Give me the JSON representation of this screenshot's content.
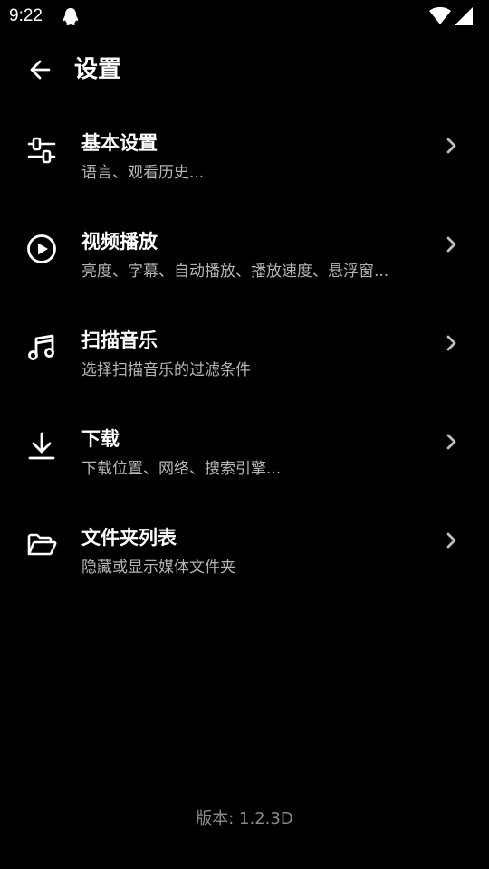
{
  "status_bar": {
    "time": "9:22"
  },
  "header": {
    "title": "设置"
  },
  "settings": {
    "items": [
      {
        "title": "基本设置",
        "subtitle": "语言、观看历史...",
        "icon": "sliders-icon"
      },
      {
        "title": "视频播放",
        "subtitle": "亮度、字幕、自动播放、播放速度、悬浮窗...",
        "icon": "play-circle-icon"
      },
      {
        "title": "扫描音乐",
        "subtitle": "选择扫描音乐的过滤条件",
        "icon": "music-note-icon"
      },
      {
        "title": "下载",
        "subtitle": "下载位置、网络、搜索引擎...",
        "icon": "download-icon"
      },
      {
        "title": "文件夹列表",
        "subtitle": "隐藏或显示媒体文件夹",
        "icon": "folder-open-icon"
      }
    ]
  },
  "footer": {
    "version": "版本: 1.2.3D"
  },
  "colors": {
    "background": "#000000",
    "text_primary": "#ffffff",
    "text_secondary": "#b5b5b5",
    "text_muted": "#8a8a8a"
  }
}
